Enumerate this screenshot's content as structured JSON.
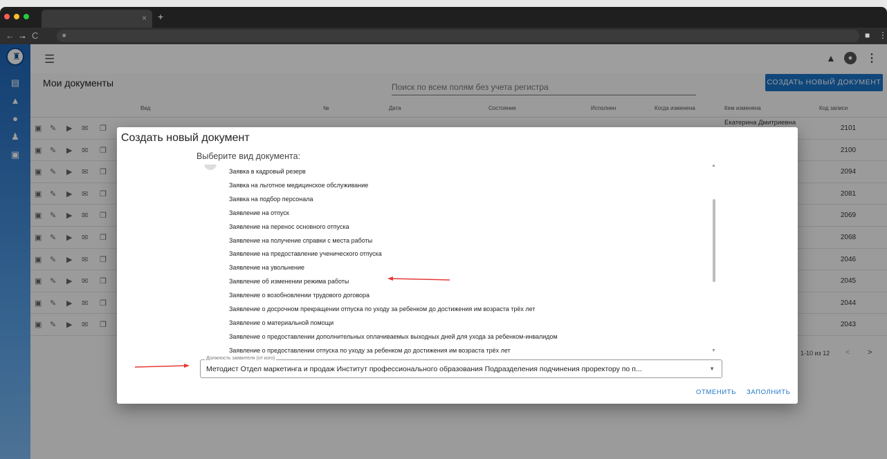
{
  "browser": {
    "tab_close": "×",
    "new_tab": "+",
    "back": "←",
    "forward": "→",
    "reload": "C"
  },
  "app": {
    "page_title": "Мои документы",
    "search_placeholder": "Поиск по всем полям без учета регистра",
    "create_button": "СОЗДАТЬ НОВЫЙ ДОКУМЕНТ",
    "accent": "#1a73c7"
  },
  "table": {
    "headers": [
      "Вид",
      "№",
      "Дата",
      "Состояние",
      "Исполнен",
      "Когда изменена",
      "Кем изменена",
      "Код записи"
    ],
    "first_row_who": "Екатерина Дмитриевна",
    "codes": [
      "2101",
      "2100",
      "2094",
      "2081",
      "2069",
      "2068",
      "2046",
      "2045",
      "2044",
      "2043"
    ],
    "pagination": "1-10 из 12",
    "prev": "<",
    "next": ">"
  },
  "dialog": {
    "title": "Создать новый документ",
    "subtitle": "Выберите вид документа:",
    "items": [
      "Заявка в кадровый резерв",
      "Заявка на льготное медицинское обслуживание",
      "Заявка на подбор персонала",
      "Заявление на отпуск",
      "Заявление на перенос основного отпуска",
      "Заявление на получение справки с места работы",
      "Заявление на предоставление ученического отпуска",
      "Заявление на увольнение",
      "Заявление об изменении режима работы",
      "Заявление о возобновлении трудового договора",
      "Заявление о досрочном прекращении отпуска по уходу за ребенком до достижения им возраста трёх лет",
      "Заявление о материальной помощи",
      "Заявление о предоставлении дополнительных оплачиваемых выходных дней для ухода за ребенком-инвалидом",
      "Заявление о предоставлении отпуска по уходу за ребенком до достижения им возраста трёх лет"
    ],
    "position_label": "Должность заявителя (от кого)",
    "position_value": "Методист Отдел маркетинга и продаж Институт профессионального образования Подразделения подчинения проректору по п...",
    "cancel": "ОТМЕНИТЬ",
    "fill": "ЗАПОЛНИТЬ"
  },
  "annotation_color": "#e53935"
}
